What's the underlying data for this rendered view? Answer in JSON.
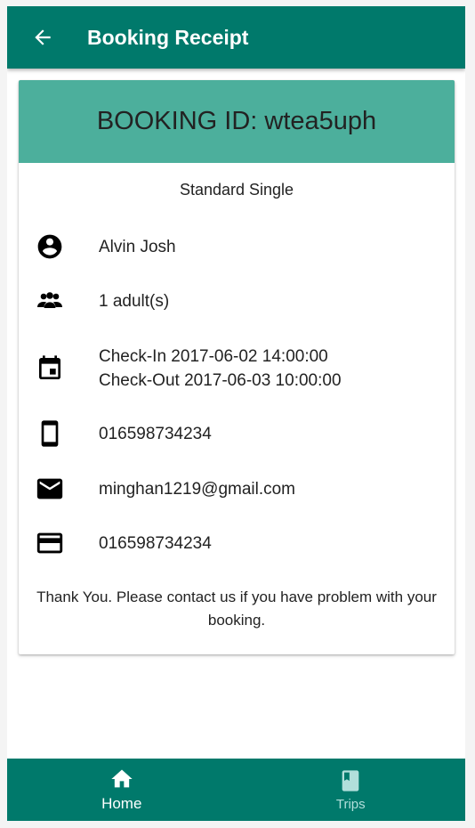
{
  "header": {
    "title": "Booking Receipt",
    "back_icon": "arrow-back-icon"
  },
  "receipt": {
    "booking_id": "BOOKING ID: wtea5uph",
    "room_type": "Standard Single",
    "guest_name": "Alvin Josh",
    "guests": "1 adult(s)",
    "check_in": "Check-In 2017-06-02 14:00:00",
    "check_out": "Check-Out 2017-06-03 10:00:00",
    "phone": "016598734234",
    "email": "minghan1219@gmail.com",
    "card": "016598734234",
    "thanks": "Thank You. Please contact us if you have problem with your booking."
  },
  "nav": {
    "home_label": "Home",
    "trips_label": "Trips"
  },
  "colors": {
    "primary": "#00796b",
    "card_header": "#4caf9c"
  }
}
